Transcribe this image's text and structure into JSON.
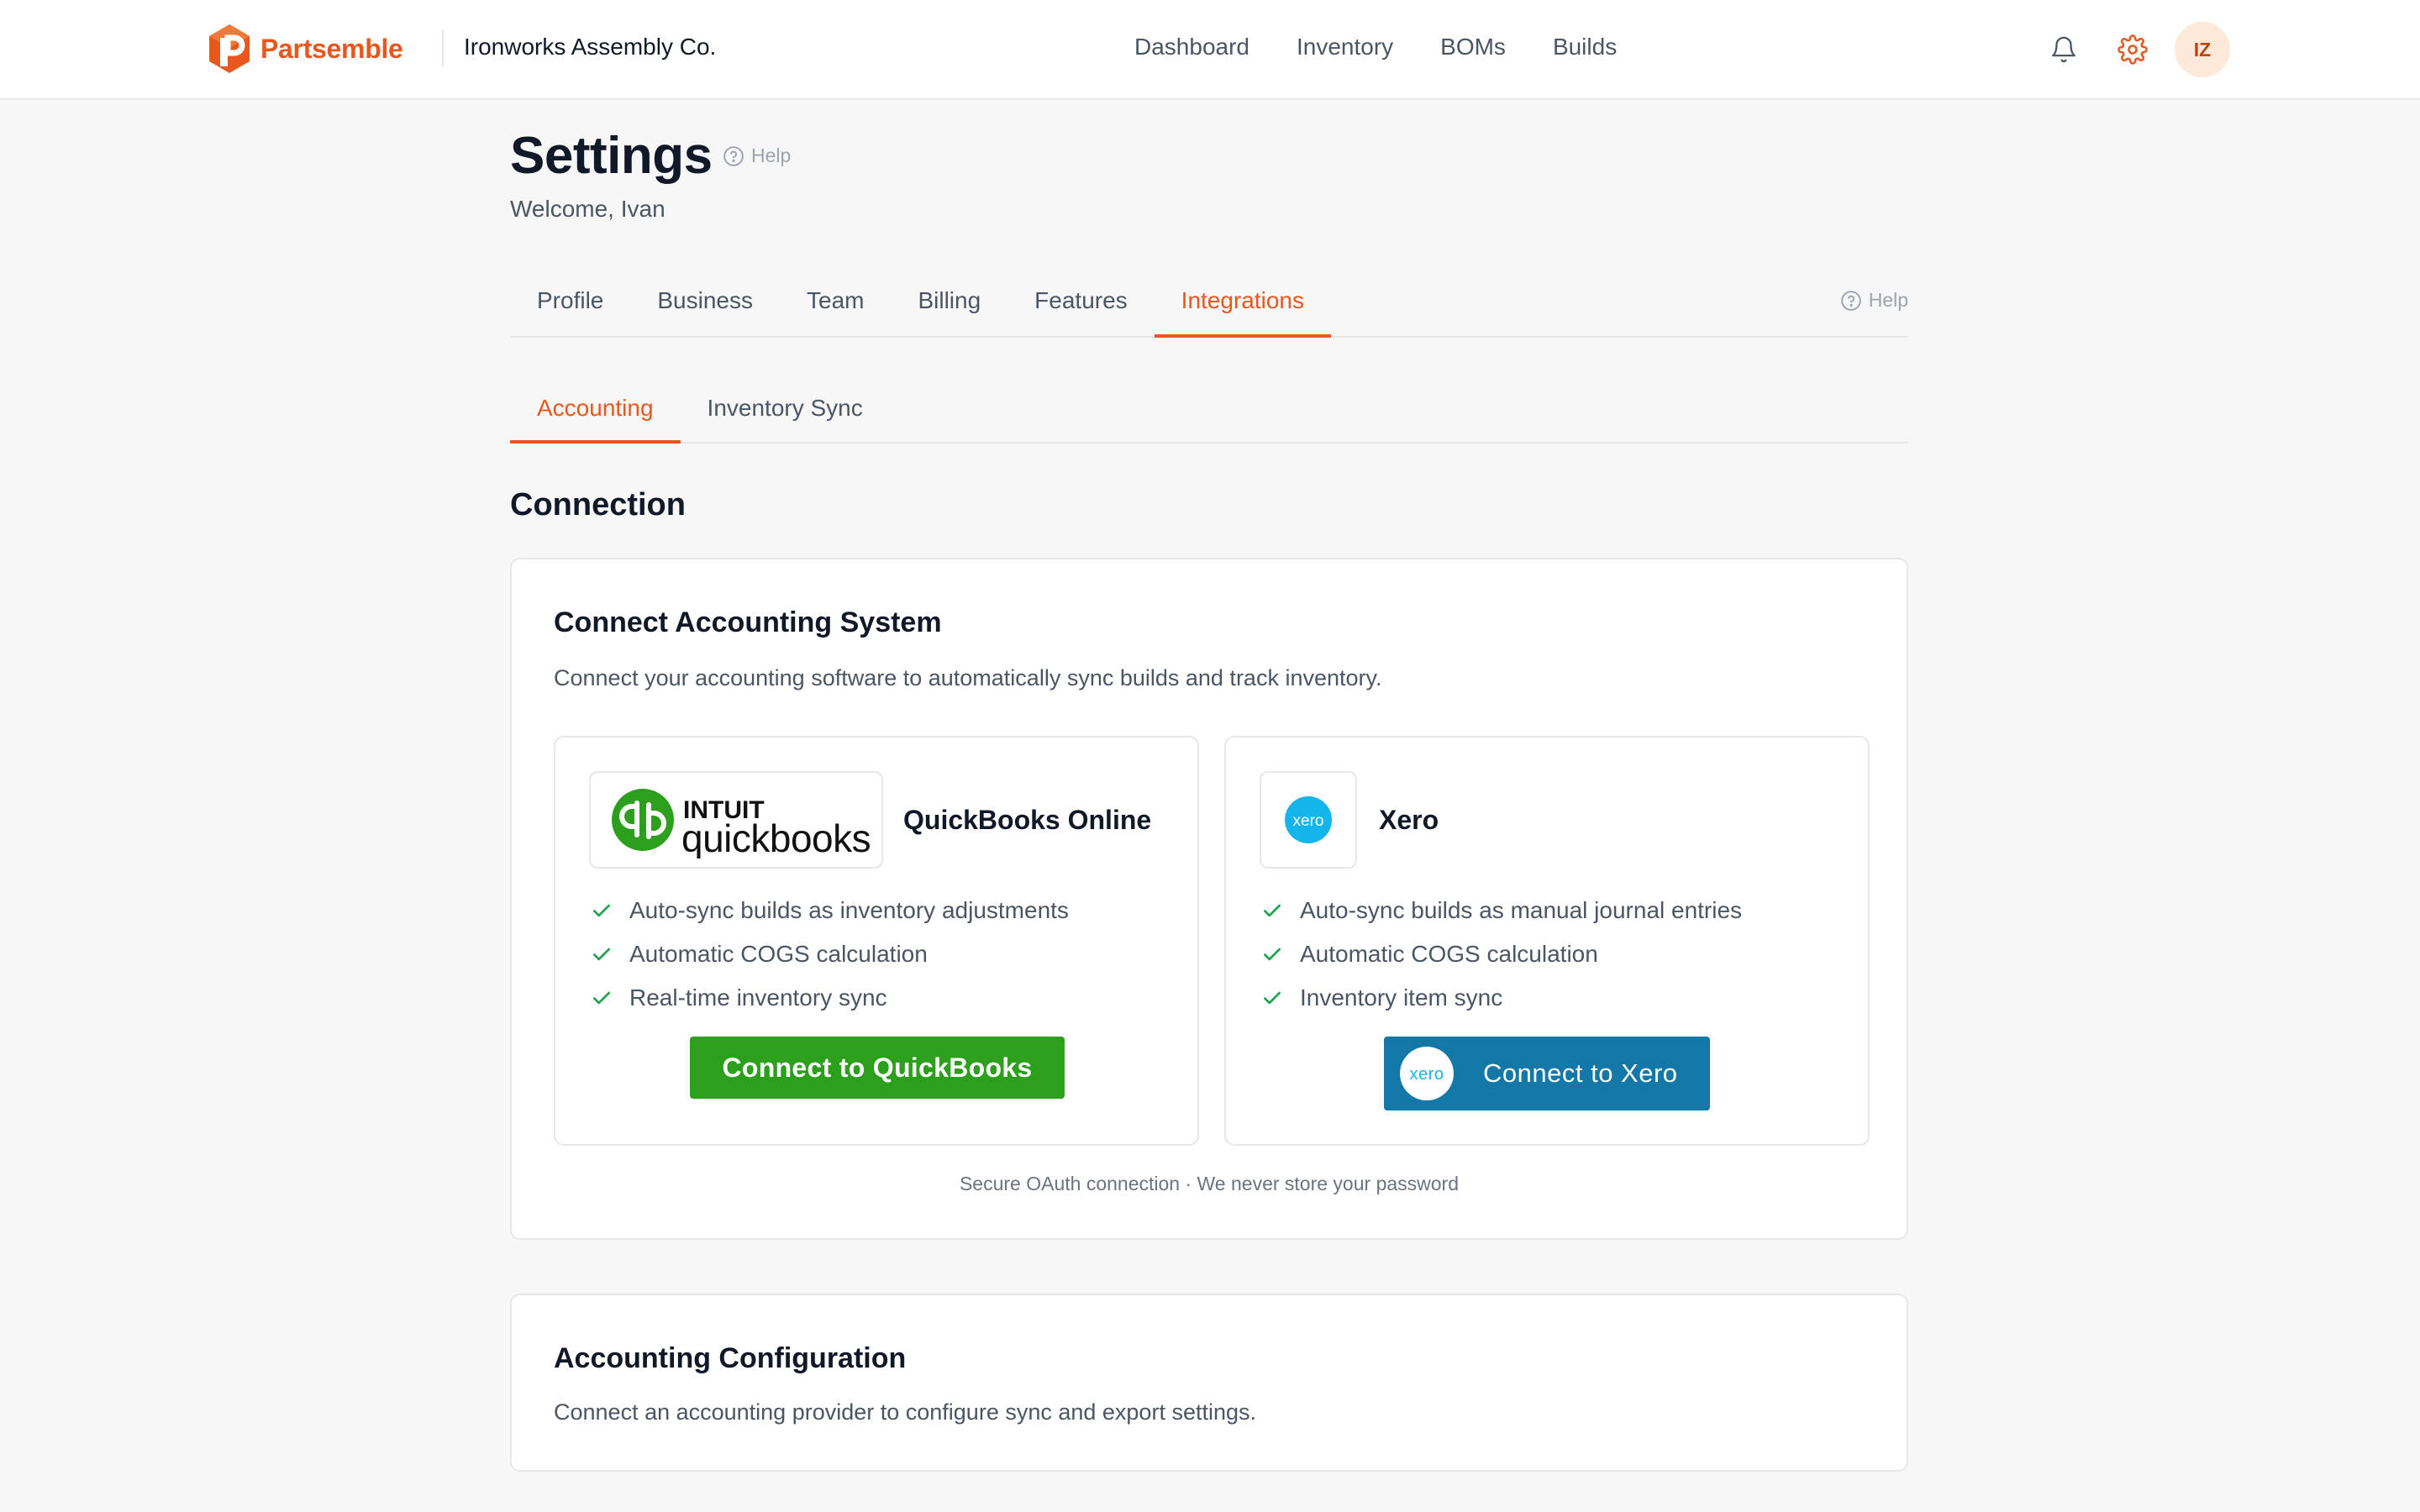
{
  "header": {
    "brand_name": "Partsemble",
    "company": "Ironworks Assembly Co.",
    "nav": [
      "Dashboard",
      "Inventory",
      "BOMs",
      "Builds"
    ],
    "notifications_icon": "bell-icon",
    "settings_icon": "gear-icon",
    "avatar_initials": "IZ",
    "brand_color": "#e8571e"
  },
  "page": {
    "title": "Settings",
    "help_label": "Help",
    "welcome": "Welcome, Ivan"
  },
  "tabs": {
    "primary": [
      "Profile",
      "Business",
      "Team",
      "Billing",
      "Features",
      "Integrations"
    ],
    "primary_active": "Integrations",
    "help_label": "Help",
    "secondary": [
      "Accounting",
      "Inventory Sync"
    ],
    "secondary_active": "Accounting"
  },
  "connection": {
    "section_title": "Connection",
    "card_title": "Connect Accounting System",
    "card_description": "Connect your accounting software to automatically sync builds and track inventory.",
    "quickbooks": {
      "logo_top": "INTUIT",
      "logo_bottom": "quickbooks",
      "name": "QuickBooks Online",
      "features": [
        "Auto-sync builds as inventory adjustments",
        "Automatic COGS calculation",
        "Real-time inventory sync"
      ],
      "button_label": "Connect to QuickBooks",
      "button_color": "#2ca01c"
    },
    "xero": {
      "logo_text": "xero",
      "name": "Xero",
      "features": [
        "Auto-sync builds as manual journal entries",
        "Automatic COGS calculation",
        "Inventory item sync"
      ],
      "button_label": "Connect to Xero",
      "button_color": "#1377a8"
    },
    "secure_note": "Secure OAuth connection · We never store your password"
  },
  "configuration": {
    "title": "Accounting Configuration",
    "description": "Connect an accounting provider to configure sync and export settings."
  }
}
